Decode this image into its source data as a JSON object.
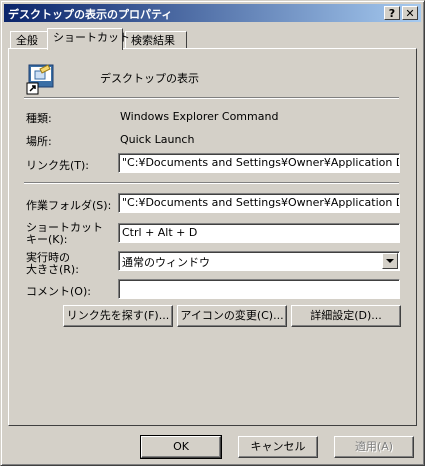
{
  "window": {
    "title": "デスクトップの表示のプロパティ",
    "help_button": "?",
    "close_button": "✕"
  },
  "tabs": [
    {
      "label": "全般"
    },
    {
      "label": "ショートカット"
    },
    {
      "label": "検索結果"
    }
  ],
  "shortcut": {
    "name": "デスクトップの表示",
    "icon": "desktop-shortcut-icon"
  },
  "info": {
    "type_label": "種類:",
    "type_value": "Windows Explorer Command",
    "location_label": "場所:",
    "location_value": "Quick Launch",
    "target_label": "リンク先(T):",
    "target_value": "\"C:¥Documents and Settings¥Owner¥Application Data"
  },
  "form": {
    "startin_label": "作業フォルダ(S):",
    "startin_value": "\"C:¥Documents and Settings¥Owner¥Application Data",
    "hotkey_label_1": "ショートカット",
    "hotkey_label_2": "キー(K):",
    "hotkey_value": "Ctrl + Alt + D",
    "run_label_1": "実行時の",
    "run_label_2": "大きさ(R):",
    "run_value": "通常のウィンドウ",
    "comment_label": "コメント(O):",
    "comment_value": ""
  },
  "actions": {
    "find_target": "リンク先を探す(F)...",
    "change_icon": "アイコンの変更(C)...",
    "advanced": "詳細設定(D)..."
  },
  "footer": {
    "ok": "OK",
    "cancel": "キャンセル",
    "apply": "適用(A)"
  }
}
